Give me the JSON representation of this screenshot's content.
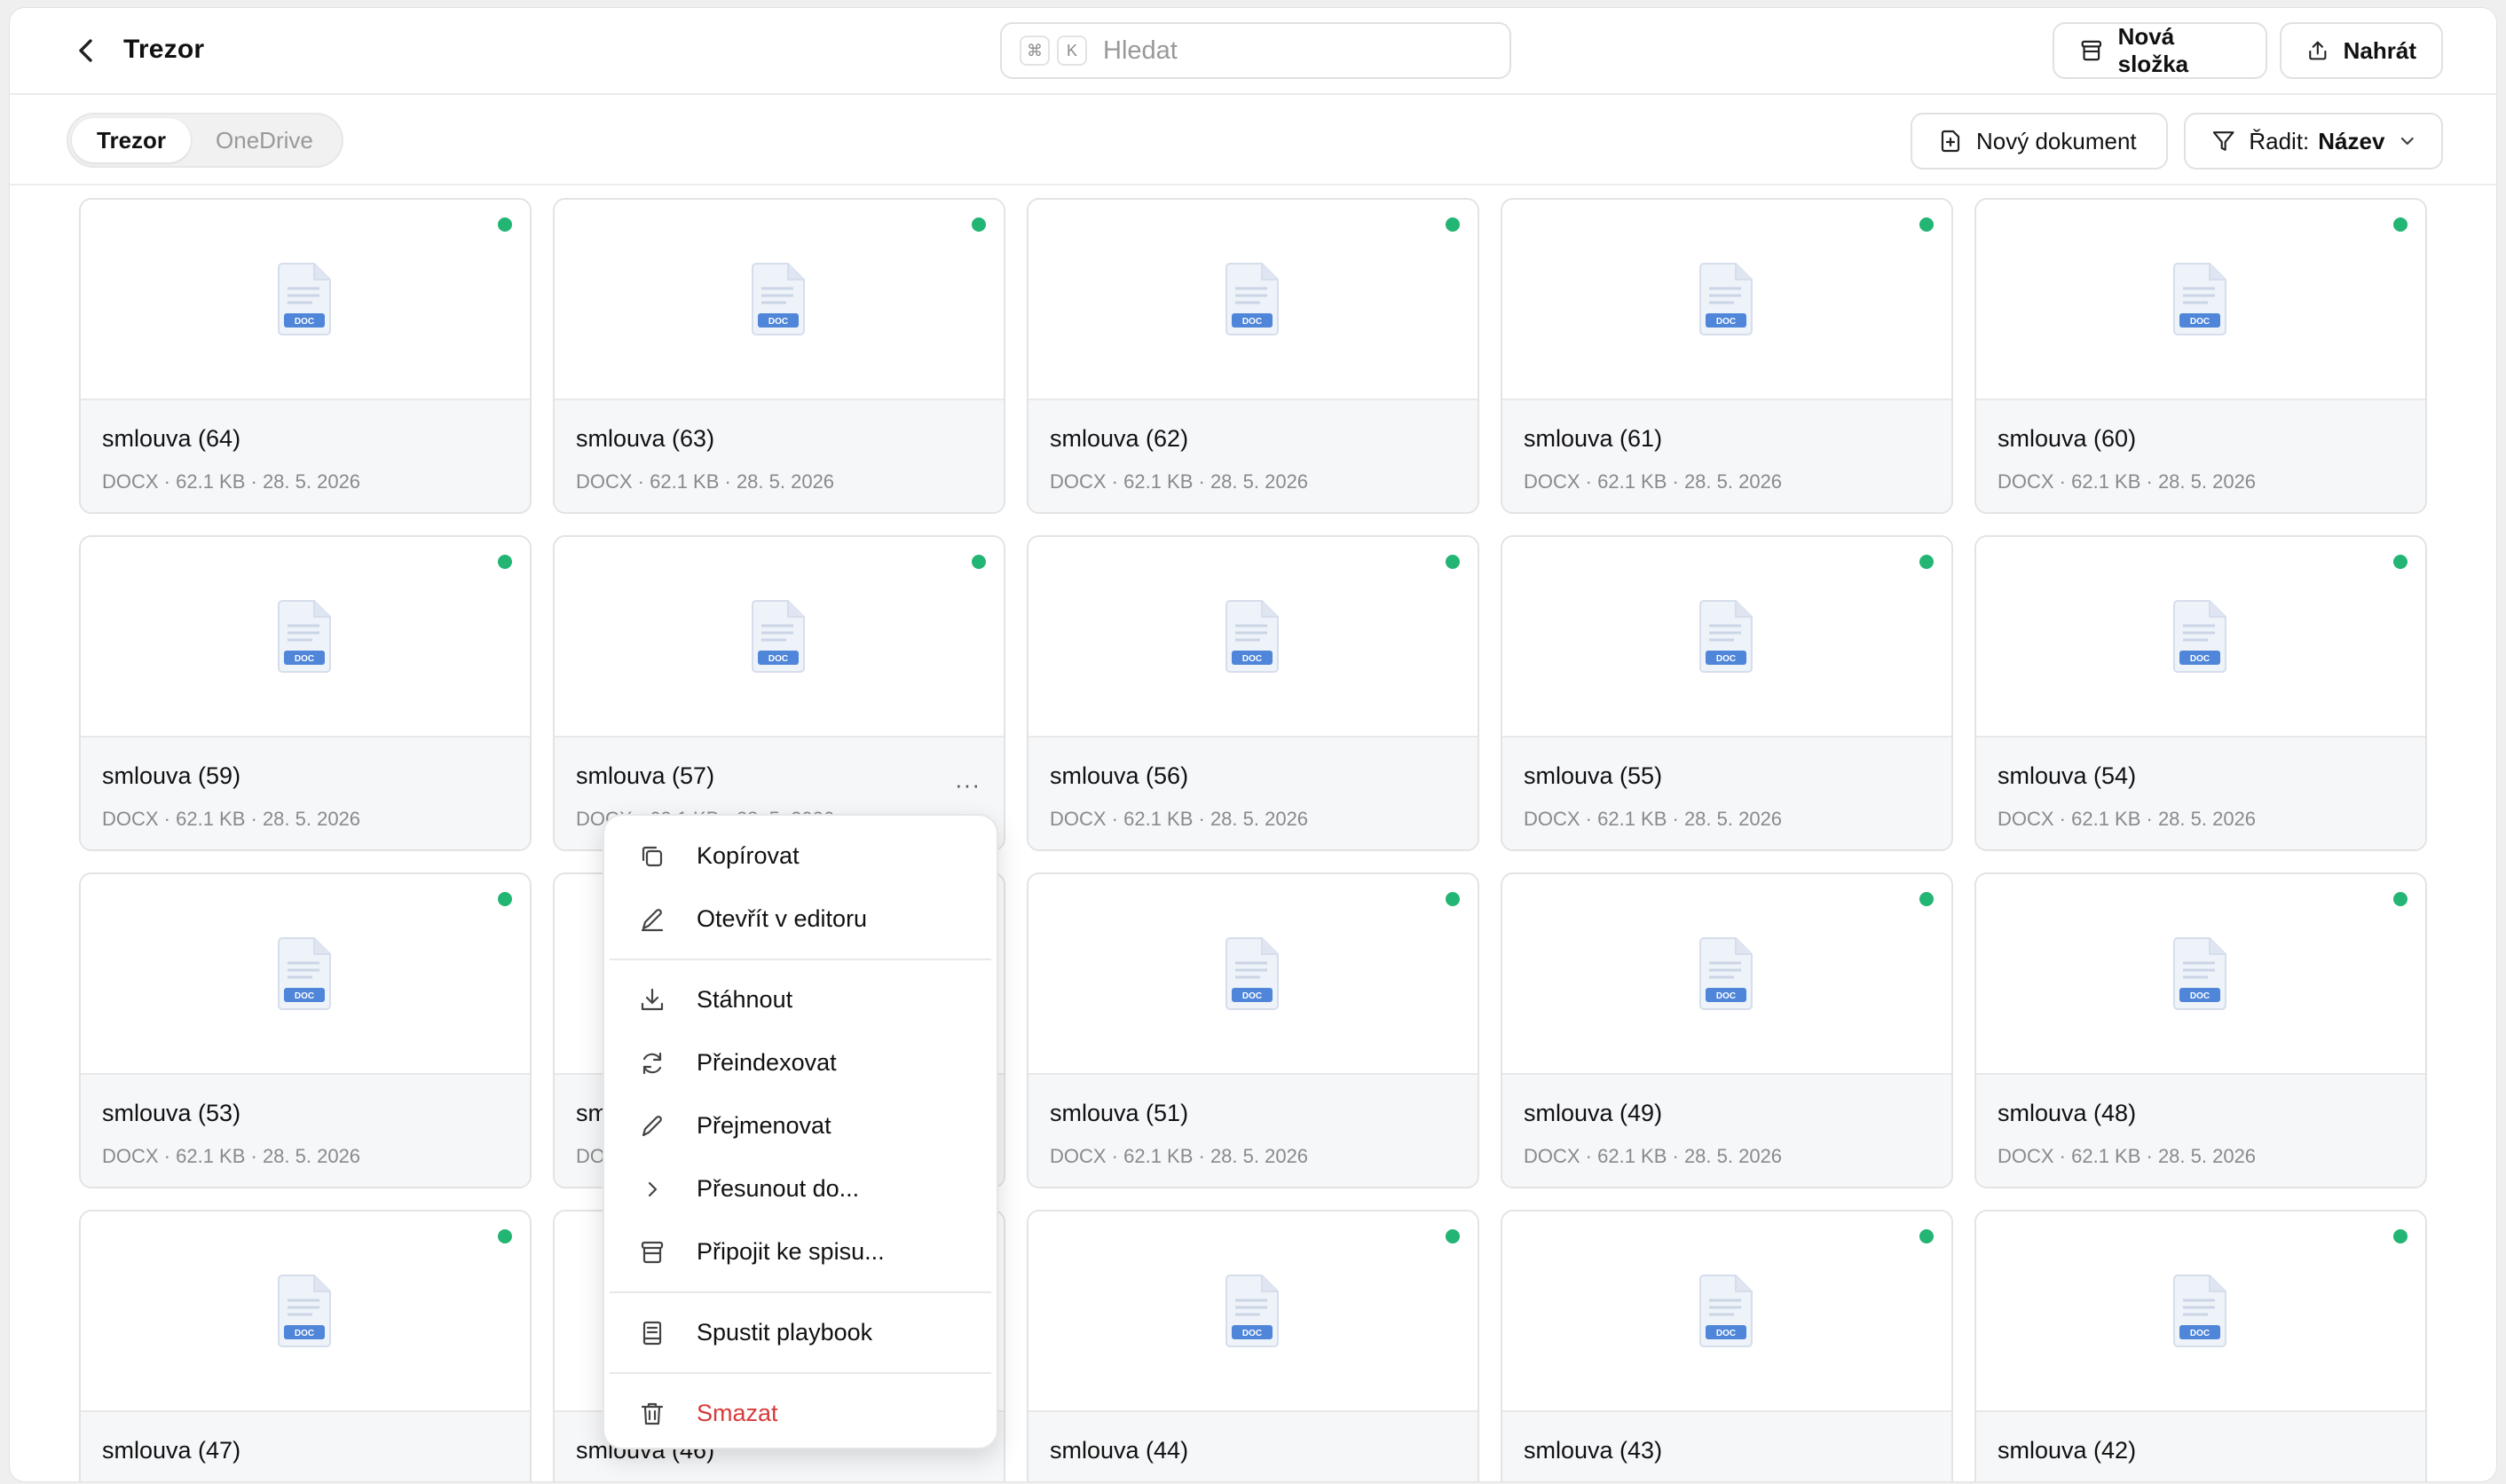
{
  "header": {
    "title": "Trezor",
    "search": {
      "shortcut_cmd": "⌘",
      "shortcut_key": "K",
      "placeholder": "Hledat"
    },
    "new_folder_label": "Nová složka",
    "upload_label": "Nahrát"
  },
  "toolbar": {
    "tabs": [
      {
        "label": "Trezor",
        "active": true
      },
      {
        "label": "OneDrive",
        "active": false
      }
    ],
    "new_document_label": "Nový dokument",
    "sort_prefix": "Řadit:",
    "sort_value": "Název"
  },
  "files": [
    {
      "name": "smlouva (64)",
      "meta": "DOCX · 62.1 KB · 28. 5. 2026"
    },
    {
      "name": "smlouva (63)",
      "meta": "DOCX · 62.1 KB · 28. 5. 2026"
    },
    {
      "name": "smlouva (62)",
      "meta": "DOCX · 62.1 KB · 28. 5. 2026"
    },
    {
      "name": "smlouva (61)",
      "meta": "DOCX · 62.1 KB · 28. 5. 2026"
    },
    {
      "name": "smlouva (60)",
      "meta": "DOCX · 62.1 KB · 28. 5. 2026"
    },
    {
      "name": "smlouva (59)",
      "meta": "DOCX · 62.1 KB · 28. 5. 2026"
    },
    {
      "name": "smlouva (57)",
      "meta": "DOCX · 62.1 KB · 28. 5. 2026"
    },
    {
      "name": "smlouva (56)",
      "meta": "DOCX · 62.1 KB · 28. 5. 2026"
    },
    {
      "name": "smlouva (55)",
      "meta": "DOCX · 62.1 KB · 28. 5. 2026"
    },
    {
      "name": "smlouva (54)",
      "meta": "DOCX · 62.1 KB · 28. 5. 2026"
    },
    {
      "name": "smlouva (53)",
      "meta": "DOCX · 62.1 KB · 28. 5. 2026"
    },
    {
      "name": "smlouva (52)",
      "meta": "DOCX · 62.1 KB · 28. 5. 2026"
    },
    {
      "name": "smlouva (51)",
      "meta": "DOCX · 62.1 KB · 28. 5. 2026"
    },
    {
      "name": "smlouva (49)",
      "meta": "DOCX · 62.1 KB · 28. 5. 2026"
    },
    {
      "name": "smlouva (48)",
      "meta": "DOCX · 62.1 KB · 28. 5. 2026"
    },
    {
      "name": "smlouva (47)",
      "meta": ""
    },
    {
      "name": "smlouva (46)",
      "meta": ""
    },
    {
      "name": "smlouva (44)",
      "meta": ""
    },
    {
      "name": "smlouva (43)",
      "meta": ""
    },
    {
      "name": "smlouva (42)",
      "meta": ""
    }
  ],
  "file_icon_label": "DOC",
  "context_menu": {
    "copy": "Kopírovat",
    "open_editor": "Otevřít v editoru",
    "download": "Stáhnout",
    "reindex": "Přeindexovat",
    "rename": "Přejmenovat",
    "move": "Přesunout do...",
    "attach": "Připojit ke spisu...",
    "playbook": "Spustit playbook",
    "delete": "Smazat"
  },
  "colors": {
    "status_dot": "#22b573",
    "doc_badge": "#4f86d9",
    "danger": "#d93a3a"
  }
}
